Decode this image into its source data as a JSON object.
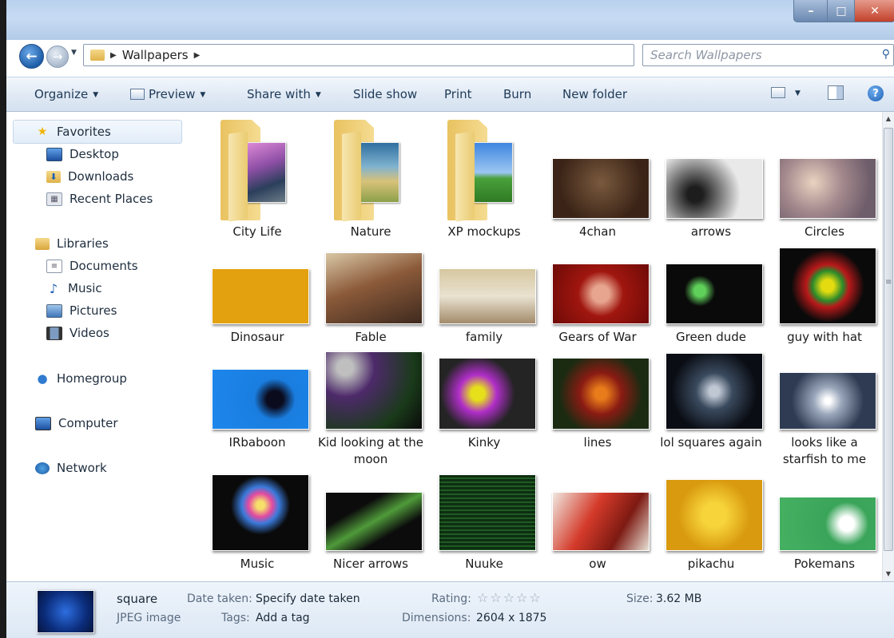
{
  "window": {
    "controls": {
      "minimize": "–",
      "maximize": "□",
      "close": "✕"
    }
  },
  "nav": {
    "back_glyph": "←",
    "forward_glyph": "→",
    "breadcrumb": [
      "Wallpapers"
    ],
    "search_placeholder": "Search Wallpapers"
  },
  "toolbar": {
    "organize": "Organize",
    "preview": "Preview",
    "share_with": "Share with",
    "slide_show": "Slide show",
    "print": "Print",
    "burn": "Burn",
    "new_folder": "New folder"
  },
  "sidebar": {
    "favorites": "Favorites",
    "favorites_items": [
      "Desktop",
      "Downloads",
      "Recent Places"
    ],
    "libraries": "Libraries",
    "libraries_items": [
      "Documents",
      "Music",
      "Pictures",
      "Videos"
    ],
    "homegroup": "Homegroup",
    "computer": "Computer",
    "network": "Network"
  },
  "items": [
    {
      "name": "City Life",
      "kind": "folder"
    },
    {
      "name": "Nature",
      "kind": "folder"
    },
    {
      "name": "XP mockups",
      "kind": "folder"
    },
    {
      "name": "4chan",
      "kind": "image"
    },
    {
      "name": "arrows",
      "kind": "image"
    },
    {
      "name": "Circles",
      "kind": "image"
    },
    {
      "name": "Dinosaur",
      "kind": "image"
    },
    {
      "name": "Fable",
      "kind": "image"
    },
    {
      "name": "family",
      "kind": "image"
    },
    {
      "name": "Gears of War",
      "kind": "image"
    },
    {
      "name": "Green dude",
      "kind": "image"
    },
    {
      "name": "guy with hat",
      "kind": "image"
    },
    {
      "name": "IRbaboon",
      "kind": "image"
    },
    {
      "name": "Kid looking at the moon",
      "kind": "image"
    },
    {
      "name": "Kinky",
      "kind": "image"
    },
    {
      "name": "lines",
      "kind": "image"
    },
    {
      "name": "lol squares again",
      "kind": "image"
    },
    {
      "name": "looks like a starfish to me",
      "kind": "image"
    },
    {
      "name": "Music",
      "kind": "image"
    },
    {
      "name": "Nicer arrows",
      "kind": "image"
    },
    {
      "name": "Nuuke",
      "kind": "image"
    },
    {
      "name": "ow",
      "kind": "image"
    },
    {
      "name": "pikachu",
      "kind": "image"
    },
    {
      "name": "Pokemans",
      "kind": "image"
    }
  ],
  "details": {
    "name": "square",
    "type": "JPEG image",
    "date_taken_label": "Date taken:",
    "date_taken_value": "Specify date taken",
    "tags_label": "Tags:",
    "tags_value": "Add a tag",
    "rating_label": "Rating:",
    "rating_stars": "☆☆☆☆☆",
    "dimensions_label": "Dimensions:",
    "dimensions_value": "2604 x 1875",
    "size_label": "Size:",
    "size_value": "3.62 MB"
  }
}
